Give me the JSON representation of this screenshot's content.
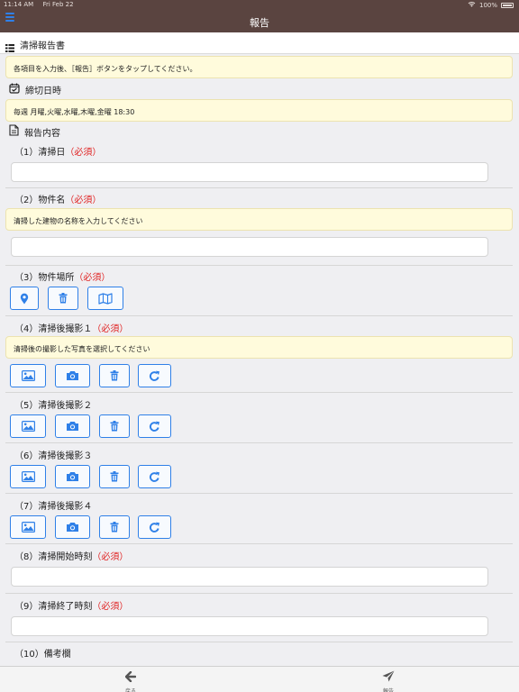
{
  "status": {
    "time": "11:14 AM",
    "date": "Fri Feb 22",
    "battery": "100%"
  },
  "nav": {
    "title": "報告"
  },
  "page": {
    "title": "清掃報告書"
  },
  "intro_note": "各項目を入力後、［報告］ボタンをタップしてください。",
  "deadline": {
    "title": "締切日時",
    "value": "毎週 月曜,火曜,水曜,木曜,金曜 18:30"
  },
  "report": {
    "title": "報告内容"
  },
  "required_mark": "（必須）",
  "fields": {
    "f1": {
      "label": "（1）清掃日"
    },
    "f2": {
      "label": "（2）物件名",
      "note": "清掃した建物の名称を入力してください"
    },
    "f3": {
      "label": "（3）物件場所"
    },
    "f4": {
      "label": "（4）清掃後撮影１",
      "note": "清掃後の撮影した写真を選択してください"
    },
    "f5": {
      "label": "（5）清掃後撮影２"
    },
    "f6": {
      "label": "（6）清掃後撮影３"
    },
    "f7": {
      "label": "（7）清掃後撮影４"
    },
    "f8": {
      "label": "（8）清掃開始時刻"
    },
    "f9": {
      "label": "（9）清掃終了時刻"
    },
    "f10": {
      "label": "（10）備考欄"
    }
  },
  "tabbar": {
    "back": "戻る",
    "report": "報告"
  },
  "colors": {
    "nav": "#5a4440",
    "accent": "#2f80e8",
    "required": "#e02020",
    "note_bg": "#fffbdc"
  },
  "icons": [
    "menu-icon",
    "list-icon",
    "calendar-check-icon",
    "document-icon",
    "location-pin-icon",
    "trash-icon",
    "map-icon",
    "image-icon",
    "camera-icon",
    "refresh-icon",
    "arrow-left-icon",
    "send-icon",
    "wifi-icon",
    "battery-icon"
  ]
}
